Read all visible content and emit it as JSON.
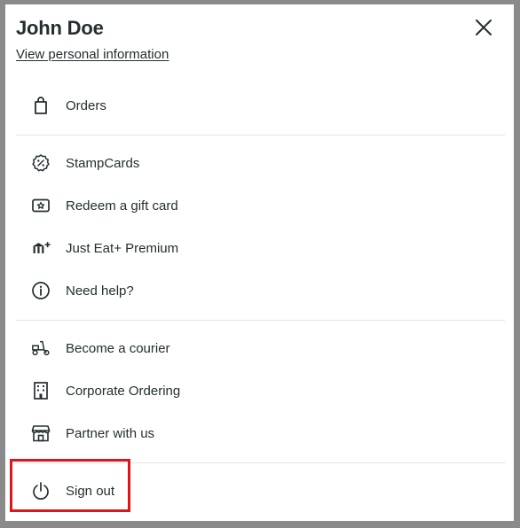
{
  "header": {
    "user_name": "John Doe",
    "personal_link": "View personal information"
  },
  "sections": [
    {
      "items": [
        {
          "label": "Orders",
          "icon": "shopping-bag-icon"
        }
      ]
    },
    {
      "items": [
        {
          "label": "StampCards",
          "icon": "stamp-discount-icon"
        },
        {
          "label": "Redeem a gift card",
          "icon": "gift-card-icon"
        },
        {
          "label": "Just Eat+ Premium",
          "icon": "premium-utensils-plus-icon"
        },
        {
          "label": "Need help?",
          "icon": "info-icon"
        }
      ]
    },
    {
      "items": [
        {
          "label": "Become a courier",
          "icon": "scooter-icon"
        },
        {
          "label": "Corporate Ordering",
          "icon": "building-icon"
        },
        {
          "label": "Partner with us",
          "icon": "storefront-icon"
        }
      ]
    },
    {
      "items": [
        {
          "label": "Sign out",
          "icon": "power-icon"
        }
      ]
    }
  ],
  "colors": {
    "text": "#242e30",
    "divider": "#e4e4e4",
    "highlight_border": "#e0151b",
    "frame": "#8a8a8a"
  }
}
